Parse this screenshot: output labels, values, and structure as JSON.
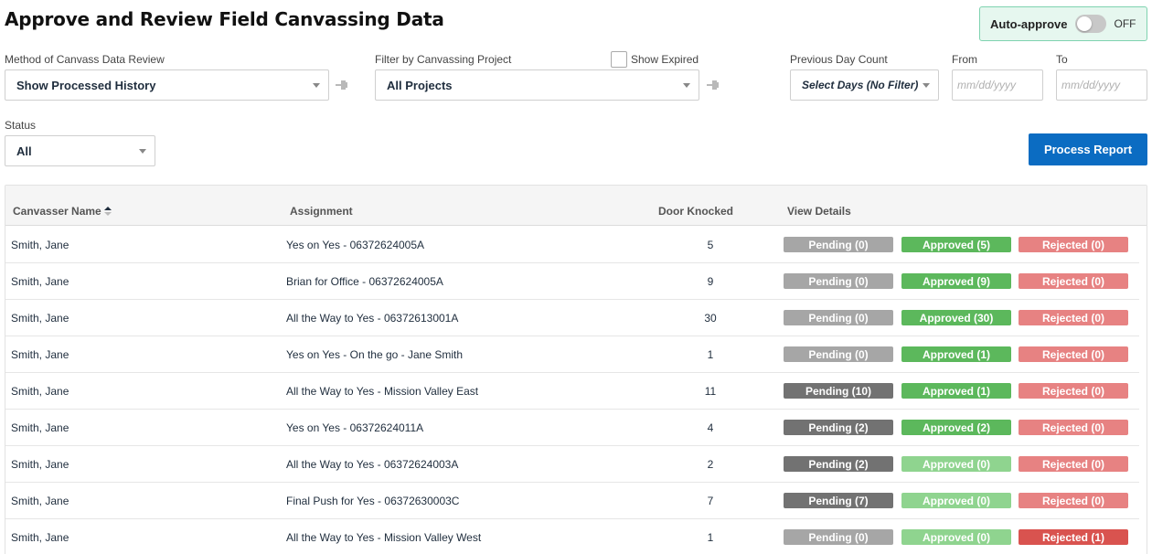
{
  "page": {
    "title": "Approve and Review Field Canvassing Data"
  },
  "auto_approve": {
    "label": "Auto-approve",
    "state": "OFF"
  },
  "filters": {
    "method": {
      "label": "Method of Canvass Data Review",
      "value": "Show Processed History"
    },
    "project": {
      "label": "Filter by Canvassing Project",
      "value": "All Projects"
    },
    "show_expired": {
      "label": "Show Expired"
    },
    "prev_day": {
      "label": "Previous Day Count",
      "value": "Select Days (No Filter)"
    },
    "from": {
      "label": "From",
      "placeholder": "mm/dd/yyyy"
    },
    "to": {
      "label": "To",
      "placeholder": "mm/dd/yyyy"
    },
    "status": {
      "label": "Status",
      "value": "All"
    }
  },
  "process_button": {
    "label": "Process Report"
  },
  "colors": {
    "pending_light": "#a6a6a6",
    "pending_dark": "#727272",
    "approved_strong": "#5cb85c",
    "approved_light": "#8fd48f",
    "rejected_light": "#e78282",
    "rejected_strong": "#d9534f",
    "primary": "#0b6cc2"
  },
  "table": {
    "headers": {
      "name": "Canvasser Name",
      "assignment": "Assignment",
      "doors": "Door Knocked",
      "details": "View Details"
    },
    "rows": [
      {
        "name": "Smith, Jane",
        "assignment": "Yes on Yes - 06372624005A",
        "doors": "5",
        "pending": "Pending (0)",
        "pending_color": "#a6a6a6",
        "approved": "Approved (5)",
        "approved_color": "#5cb85c",
        "rejected": "Rejected (0)",
        "rejected_color": "#e78282"
      },
      {
        "name": "Smith, Jane",
        "assignment": "Brian for Office - 06372624005A",
        "doors": "9",
        "pending": "Pending (0)",
        "pending_color": "#a6a6a6",
        "approved": "Approved (9)",
        "approved_color": "#5cb85c",
        "rejected": "Rejected (0)",
        "rejected_color": "#e78282"
      },
      {
        "name": "Smith, Jane",
        "assignment": "All the Way to Yes - 06372613001A",
        "doors": "30",
        "pending": "Pending (0)",
        "pending_color": "#a6a6a6",
        "approved": "Approved (30)",
        "approved_color": "#5cb85c",
        "rejected": "Rejected (0)",
        "rejected_color": "#e78282"
      },
      {
        "name": "Smith, Jane",
        "assignment": "Yes on Yes - On the go - Jane Smith",
        "doors": "1",
        "pending": "Pending (0)",
        "pending_color": "#a6a6a6",
        "approved": "Approved (1)",
        "approved_color": "#5cb85c",
        "rejected": "Rejected (0)",
        "rejected_color": "#e78282"
      },
      {
        "name": "Smith, Jane",
        "assignment": "All the Way to Yes - Mission Valley East",
        "doors": "11",
        "pending": "Pending (10)",
        "pending_color": "#727272",
        "approved": "Approved (1)",
        "approved_color": "#5cb85c",
        "rejected": "Rejected (0)",
        "rejected_color": "#e78282"
      },
      {
        "name": "Smith, Jane",
        "assignment": "Yes on Yes - 06372624011A",
        "doors": "4",
        "pending": "Pending (2)",
        "pending_color": "#727272",
        "approved": "Approved (2)",
        "approved_color": "#5cb85c",
        "rejected": "Rejected (0)",
        "rejected_color": "#e78282"
      },
      {
        "name": "Smith, Jane",
        "assignment": "All the Way to Yes - 06372624003A",
        "doors": "2",
        "pending": "Pending (2)",
        "pending_color": "#727272",
        "approved": "Approved (0)",
        "approved_color": "#8fd48f",
        "rejected": "Rejected (0)",
        "rejected_color": "#e78282"
      },
      {
        "name": "Smith, Jane",
        "assignment": "Final Push for Yes - 06372630003C",
        "doors": "7",
        "pending": "Pending (7)",
        "pending_color": "#727272",
        "approved": "Approved (0)",
        "approved_color": "#8fd48f",
        "rejected": "Rejected (0)",
        "rejected_color": "#e78282"
      },
      {
        "name": "Smith, Jane",
        "assignment": "All the Way to Yes - Mission Valley West",
        "doors": "1",
        "pending": "Pending (0)",
        "pending_color": "#a6a6a6",
        "approved": "Approved (0)",
        "approved_color": "#8fd48f",
        "rejected": "Rejected (1)",
        "rejected_color": "#d9534f"
      }
    ]
  }
}
